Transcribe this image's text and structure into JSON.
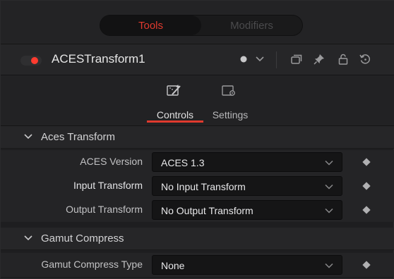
{
  "tabs": {
    "tools": "Tools",
    "modifiers": "Modifiers"
  },
  "header": {
    "node_name": "ACESTransform1",
    "active": true
  },
  "subtabs": {
    "controls": "Controls",
    "settings": "Settings"
  },
  "sections": {
    "aces": {
      "title": "Aces Transform",
      "rows": [
        {
          "label": "ACES Version",
          "value": "ACES 1.3"
        },
        {
          "label": "Input Transform",
          "value": "No Input Transform"
        },
        {
          "label": "Output Transform",
          "value": "No Output Transform"
        }
      ]
    },
    "gamut": {
      "title": "Gamut Compress",
      "rows": [
        {
          "label": "Gamut Compress Type",
          "value": "None"
        }
      ]
    }
  },
  "colors": {
    "accent": "#e03a2e",
    "enabled_dot": "#ff3b2f"
  }
}
